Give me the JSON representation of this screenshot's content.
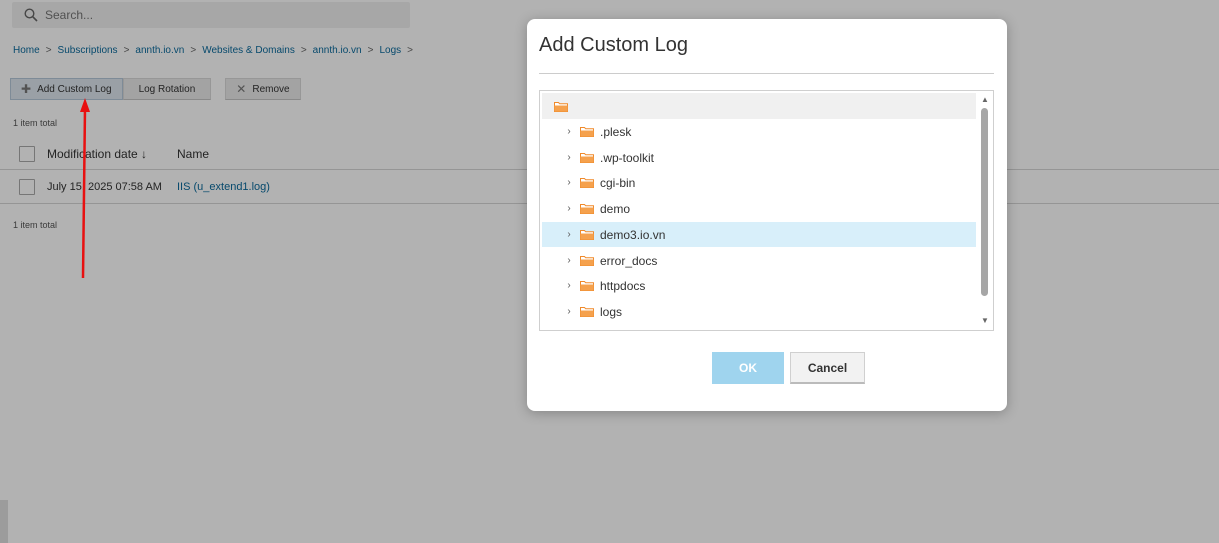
{
  "search": {
    "placeholder": "Search..."
  },
  "breadcrumb": [
    "Home",
    "Subscriptions",
    "annth.io.vn",
    "Websites & Domains",
    "annth.io.vn",
    "Logs"
  ],
  "breadcrumb_sep": ">",
  "toolbar": {
    "add_custom_log": "Add Custom Log",
    "log_rotation": "Log Rotation",
    "remove": "Remove"
  },
  "total_top": "1 item total",
  "total_bottom": "1 item total",
  "table": {
    "headers": {
      "date": "Modification date ↓",
      "name": "Name"
    },
    "rows": [
      {
        "date": "July 15, 2025 07:58 AM",
        "name": "IIS (u_extend1.log)"
      }
    ]
  },
  "dialog": {
    "title": "Add Custom Log",
    "ok_label": "OK",
    "cancel_label": "Cancel",
    "folders": [
      ".plesk",
      ".wp-toolkit",
      "cgi-bin",
      "demo",
      "demo3.io.vn",
      "error_docs",
      "httpdocs",
      "logs"
    ],
    "selected_folder": "demo3.io.vn"
  },
  "colors": {
    "link": "#0b6a9c",
    "folder": "#f5a14d",
    "selected_row": "#d8effa",
    "ok_button": "#9fd4ee",
    "arrow": "#e81010"
  }
}
